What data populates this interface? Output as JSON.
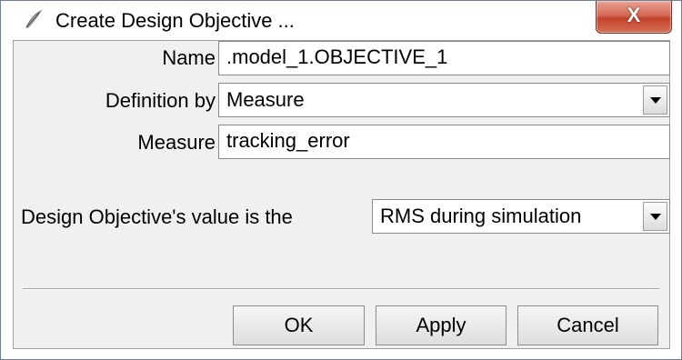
{
  "window": {
    "title": "Create Design Objective ...",
    "close_label": "X",
    "icon": "feather-icon"
  },
  "form": {
    "name_label": "Name",
    "name_value": ".model_1.OBJECTIVE_1",
    "definition_label": "Definition by",
    "definition_value": "Measure",
    "measure_label": "Measure",
    "measure_value": "tracking_error",
    "value_label": "Design Objective's value is the",
    "value_option": "RMS during simulation"
  },
  "buttons": {
    "ok": "OK",
    "apply": "Apply",
    "cancel": "Cancel"
  }
}
